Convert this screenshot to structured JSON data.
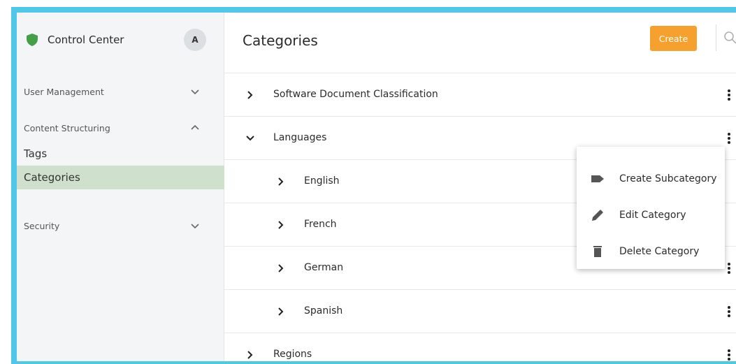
{
  "sidebar": {
    "brand": "Control Center",
    "avatar": "A",
    "groups": {
      "user_management": "User Management",
      "content_structuring": "Content Structuring",
      "security": "Security"
    },
    "items": {
      "tags": "Tags",
      "categories": "Categories"
    }
  },
  "header": {
    "title": "Categories",
    "create_label": "Create"
  },
  "rows": [
    {
      "label": "Software Document Classification",
      "expanded": false
    },
    {
      "label": "Languages",
      "expanded": true
    },
    {
      "label": "English",
      "expanded": false
    },
    {
      "label": "French",
      "expanded": false
    },
    {
      "label": "German",
      "expanded": false
    },
    {
      "label": "Spanish",
      "expanded": false
    },
    {
      "label": "Regions",
      "expanded": false
    }
  ],
  "context_menu": {
    "create_subcategory": "Create Subcategory",
    "edit_category": "Edit Category",
    "delete_category": "Delete Category"
  },
  "colors": {
    "accent": "#f6a12d",
    "frame": "#4fc7e9",
    "active_nav": "#cfe0cc",
    "brand_icon": "#43a047"
  },
  "icons": {
    "brand": "shield-icon",
    "search": "search-icon",
    "menu": [
      "tag-icon",
      "pencil-icon",
      "trash-icon"
    ]
  }
}
